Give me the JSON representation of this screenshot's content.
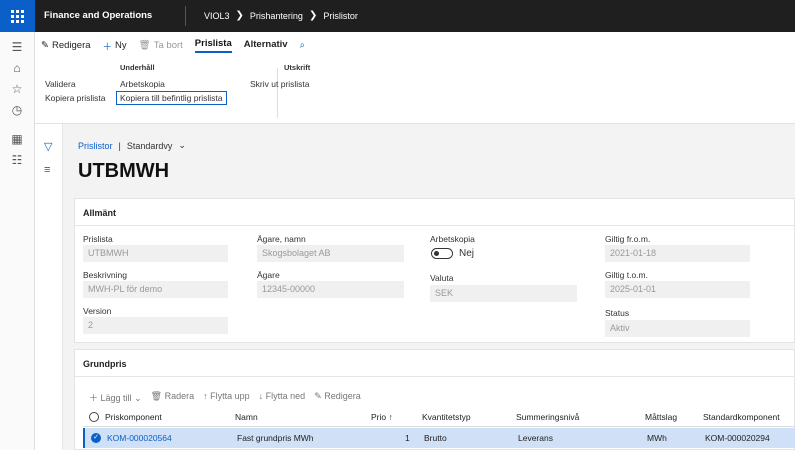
{
  "app": {
    "title": "Finance and Operations"
  },
  "breadcrumb": [
    "VIOL3",
    "Prishantering",
    "Prislistor"
  ],
  "action_pane": {
    "buttons": {
      "edit": "Redigera",
      "new": "Ny",
      "delete": "Ta bort"
    },
    "tabs": [
      "Prislista",
      "Alternativ"
    ],
    "groups": {
      "maintain": {
        "title": "Underhåll",
        "items": [
          "Validera",
          "Arbetskopia",
          "Kopiera prislista",
          "Kopiera till befintlig prislista"
        ]
      },
      "print": {
        "title": "Utskrift",
        "items": [
          "Skriv ut prislista"
        ]
      }
    }
  },
  "view": {
    "link": "Prislistor",
    "sep": "|",
    "view_name": "Standardvy"
  },
  "record_title": "UTBMWH",
  "general": {
    "header": "Allmänt",
    "fields": {
      "price_list": {
        "label": "Prislista",
        "value": "UTBMWH"
      },
      "description": {
        "label": "Beskrivning",
        "value": "MWH-PL för demo"
      },
      "version": {
        "label": "Version",
        "value": "2"
      },
      "owner_name": {
        "label": "Ägare, namn",
        "value": "Skogsbolaget AB"
      },
      "owner": {
        "label": "Ägare",
        "value": "12345-00000"
      },
      "working_copy": {
        "label": "Arbetskopia",
        "value": "Nej"
      },
      "currency": {
        "label": "Valuta",
        "value": "SEK"
      },
      "valid_from": {
        "label": "Giltig fr.o.m.",
        "value": "2021-01-18"
      },
      "valid_to": {
        "label": "Giltig t.o.m.",
        "value": "2025-01-01"
      },
      "status": {
        "label": "Status",
        "value": "Aktiv"
      }
    }
  },
  "base_price": {
    "header": "Grundpris",
    "toolbar": {
      "add": "Lägg till",
      "delete": "Radera",
      "move_up": "Flytta upp",
      "move_down": "Flytta ned",
      "edit": "Redigera"
    },
    "columns": [
      "Priskomponent",
      "Namn",
      "Prio ↑",
      "Kvantitetstyp",
      "Summeringsnivå",
      "Måttslag",
      "Standardkomponent"
    ],
    "rows": [
      {
        "component": "KOM-000020564",
        "name": "Fast grundpris MWh",
        "prio": "1",
        "qty_type": "Brutto",
        "sum_level": "Leverans",
        "unit": "MWh",
        "std_component": "KOM-000020294"
      }
    ]
  },
  "colors": {
    "accent": "#0b5fc8",
    "topbar": "#1f1f1f",
    "selected_row": "#cfe0f7"
  }
}
